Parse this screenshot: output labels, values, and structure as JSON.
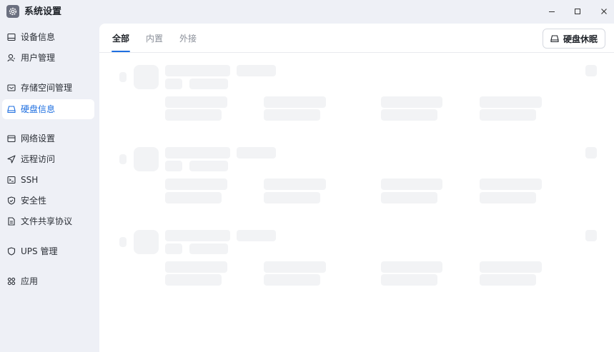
{
  "window": {
    "title": "系统设置",
    "app_icon": "gear-icon",
    "controls": [
      "minimize-icon",
      "maximize-icon",
      "close-icon"
    ]
  },
  "sidebar": {
    "items": [
      {
        "label": "设备信息",
        "icon": "device-info-icon",
        "active": false
      },
      {
        "label": "用户管理",
        "icon": "user-icon",
        "active": false
      },
      {
        "label": "存储空间管理",
        "icon": "storage-icon",
        "active": false
      },
      {
        "label": "硬盘信息",
        "icon": "disk-icon",
        "active": true
      },
      {
        "label": "网络设置",
        "icon": "network-icon",
        "active": false
      },
      {
        "label": "远程访问",
        "icon": "send-icon",
        "active": false
      },
      {
        "label": "SSH",
        "icon": "terminal-icon",
        "active": false
      },
      {
        "label": "安全性",
        "icon": "shield-check-icon",
        "active": false
      },
      {
        "label": "文件共享协议",
        "icon": "file-icon",
        "active": false
      },
      {
        "label": "UPS 管理",
        "icon": "shield-icon",
        "active": false
      },
      {
        "label": "应用",
        "icon": "apps-icon",
        "active": false
      }
    ]
  },
  "main": {
    "tabs": [
      {
        "label": "全部",
        "active": true
      },
      {
        "label": "内置",
        "active": false
      },
      {
        "label": "外接",
        "active": false
      }
    ],
    "sleep_button": "硬盘休眠",
    "skeleton_cards": 3
  },
  "colors": {
    "accent": "#1f6fe0",
    "sidebar_bg": "#eef0f6",
    "panel_bg": "#ffffff",
    "skeleton": "#f2f3f5"
  }
}
